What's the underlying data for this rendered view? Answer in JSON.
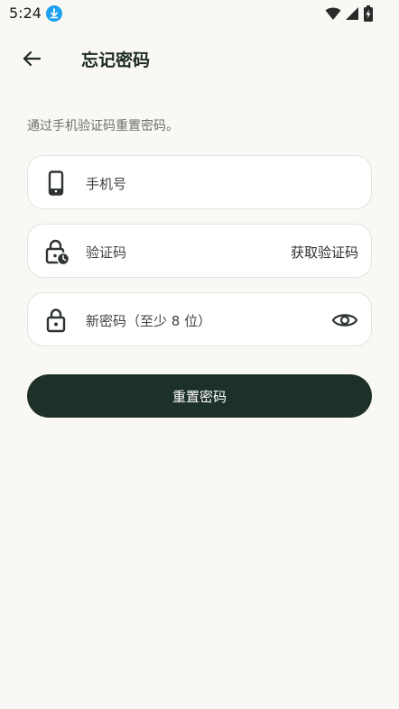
{
  "status_bar": {
    "time": "5:24"
  },
  "header": {
    "title": "忘记密码"
  },
  "hint": "通过手机验证码重置密码。",
  "form": {
    "phone": {
      "placeholder": "手机号",
      "icon": "phone-icon"
    },
    "code": {
      "placeholder": "验证码",
      "icon": "lock-clock-icon",
      "action_label": "获取验证码"
    },
    "password": {
      "placeholder": "新密码（至少 8 位）",
      "icon": "lock-icon",
      "toggle_icon": "eye-icon"
    }
  },
  "submit_label": "重置密码",
  "colors": {
    "primary": "#1d3129",
    "background": "#faf8f4",
    "badge": "#1da1f2"
  }
}
